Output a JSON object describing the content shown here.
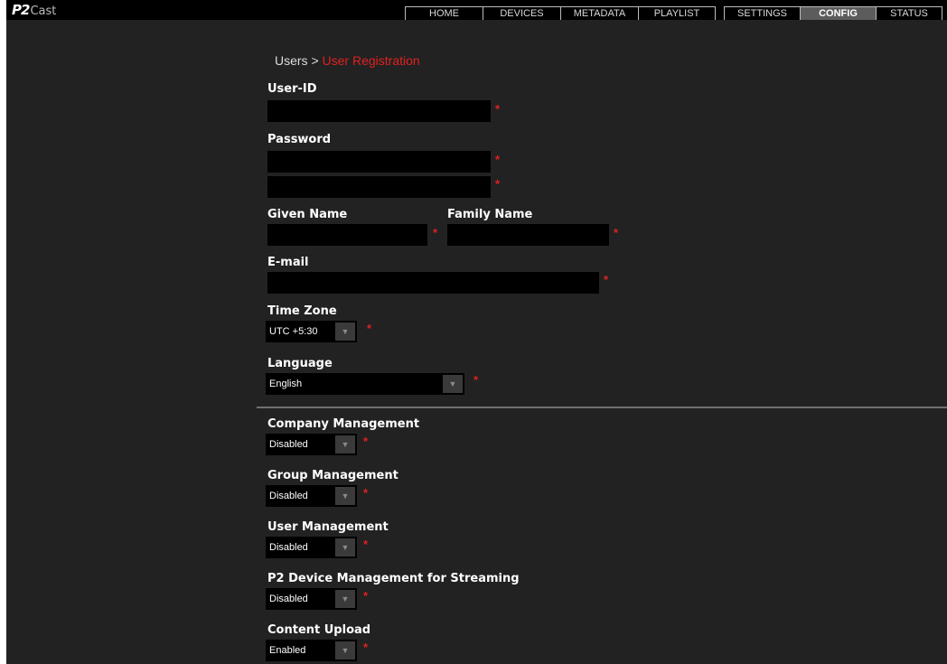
{
  "app": {
    "logo_p2": "P2",
    "logo_cast": "Cast",
    "nav_main": [
      {
        "label": "HOME",
        "active": false
      },
      {
        "label": "DEVICES",
        "active": false
      },
      {
        "label": "METADATA",
        "active": false
      },
      {
        "label": "PLAYLIST",
        "active": false
      }
    ],
    "nav_system": [
      {
        "label": "SETTINGS",
        "active": false
      },
      {
        "label": "CONFIG",
        "active": true
      },
      {
        "label": "STATUS",
        "active": false
      }
    ],
    "accent_color": "#e02020"
  },
  "breadcrumb": {
    "parent": "Users",
    "separator": " > ",
    "current": "User Registration"
  },
  "form": {
    "user_id": {
      "label": "User-ID",
      "value": ""
    },
    "password": {
      "label": "Password",
      "value": "",
      "confirm_value": ""
    },
    "given_name": {
      "label": "Given Name",
      "value": ""
    },
    "family_name": {
      "label": "Family Name",
      "value": ""
    },
    "email": {
      "label": "E-mail",
      "value": ""
    },
    "time_zone": {
      "label": "Time Zone",
      "value": "UTC +5:30"
    },
    "language": {
      "label": "Language",
      "value": "English"
    },
    "company_management": {
      "label": "Company Management",
      "value": "Disabled"
    },
    "group_management": {
      "label": "Group Management",
      "value": "Disabled"
    },
    "user_management": {
      "label": "User Management",
      "value": "Disabled"
    },
    "p2_device_management": {
      "label": "P2 Device Management for Streaming",
      "value": "Disabled"
    },
    "content_upload": {
      "label": "Content Upload",
      "value": "Enabled"
    },
    "required_mark": "*",
    "dropdown_arrow": "▼"
  }
}
